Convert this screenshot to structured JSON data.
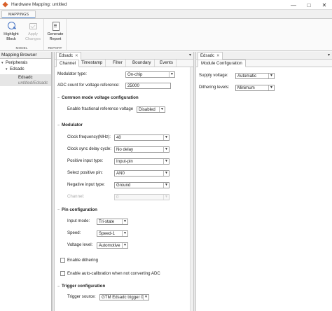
{
  "window": {
    "title": "Hardware Mapping: untitled",
    "minimize": "—",
    "maximize": "□",
    "close": "✕"
  },
  "ribbon": {
    "tab": "MAPPINGS",
    "groups": [
      {
        "label": "MODEL",
        "buttons": [
          {
            "label_line1": "Highlight",
            "label_line2": "Block"
          },
          {
            "label_line1": "Apply",
            "label_line2": "Changes"
          }
        ]
      },
      {
        "label": "REPORT",
        "buttons": [
          {
            "label_line1": "Generate",
            "label_line2": "Report"
          }
        ]
      }
    ]
  },
  "browser": {
    "title": "Mapping Browser",
    "tree": [
      {
        "label": "Peripherals",
        "arrow": "▾"
      },
      {
        "label": "Edsadc",
        "arrow": "▾"
      },
      {
        "label": "Edsadc",
        "sub": "untitled/Edsadc"
      }
    ]
  },
  "left_doc": {
    "tab": "Edsadc",
    "close": "✕",
    "subtabs": [
      "Channel",
      "Timestamp",
      "Filter",
      "Boundary",
      "Events"
    ],
    "modulator_type": {
      "label": "Modulator type:",
      "value": "On-chip"
    },
    "adc_count": {
      "label": "ADC count for voltage reference:",
      "value": "25000"
    },
    "common_mode": {
      "title": "Common mode voltage configuration",
      "enable_fractional": {
        "label": "Enable fractional reference voltage",
        "value": "Disabled"
      }
    },
    "modulator": {
      "title": "Modulator",
      "clock_frequency": {
        "label": "Clock frequency(MHz):",
        "value": "40"
      },
      "clock_sync": {
        "label": "Clock sync delay cycle:",
        "value": "No delay"
      },
      "positive_input_type": {
        "label": "Positive input type:",
        "value": "Input-pin"
      },
      "select_positive_pin": {
        "label": "Select positive pin:",
        "value": "AN0"
      },
      "negative_input_type": {
        "label": "Negative input type:",
        "value": "Ground"
      },
      "channel": {
        "label": "Channel:",
        "value": "0"
      }
    },
    "pin_config": {
      "title": "Pin configuration",
      "input_mode": {
        "label": "Input mode:",
        "value": "Tri-state"
      },
      "speed": {
        "label": "Speed:",
        "value": "Speed-1"
      },
      "voltage_level": {
        "label": "Voltage level:",
        "value": "Automotive"
      }
    },
    "enable_dithering": "Enable dithering",
    "enable_autocal": "Enable auto-calibration when not converting ADC",
    "trigger": {
      "title": "Trigger configuration",
      "trigger_source": {
        "label": "Trigger source:",
        "value": "GTM Edsadc trigger 0"
      }
    }
  },
  "right_doc": {
    "tab": "Edsadc",
    "close": "✕",
    "subtab": "Module Configuration",
    "supply_voltage": {
      "label": "Supply voltage:",
      "value": "Automatic"
    },
    "dithering_levels": {
      "label": "Dithering levels:",
      "value": "Minimum"
    }
  }
}
